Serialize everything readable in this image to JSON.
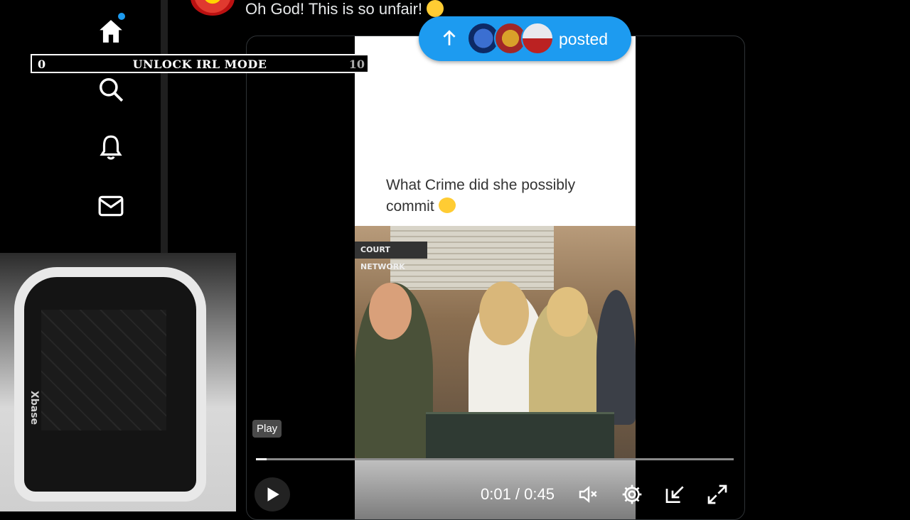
{
  "nav": {
    "items": [
      {
        "name": "home",
        "icon": "home-icon"
      },
      {
        "name": "search",
        "icon": "search-icon"
      },
      {
        "name": "notifications",
        "icon": "bell-icon"
      },
      {
        "name": "messages",
        "icon": "mail-icon"
      }
    ],
    "accent_color": "#1d9bf0"
  },
  "irl_bar": {
    "min": "0",
    "title": "UNLOCK IRL MODE",
    "max": "10"
  },
  "webcam": {
    "chair_brand": "Xbase"
  },
  "post": {
    "text": "Oh God! This is so unfair!"
  },
  "video": {
    "caption": "What Crime did she possibly commit",
    "watermark": "COURT NETWORK",
    "tooltip": "Play",
    "time": "0:01 / 0:45",
    "progress": 0.022
  },
  "posted_pill": {
    "label": "posted",
    "color": "#1d9bf0"
  }
}
